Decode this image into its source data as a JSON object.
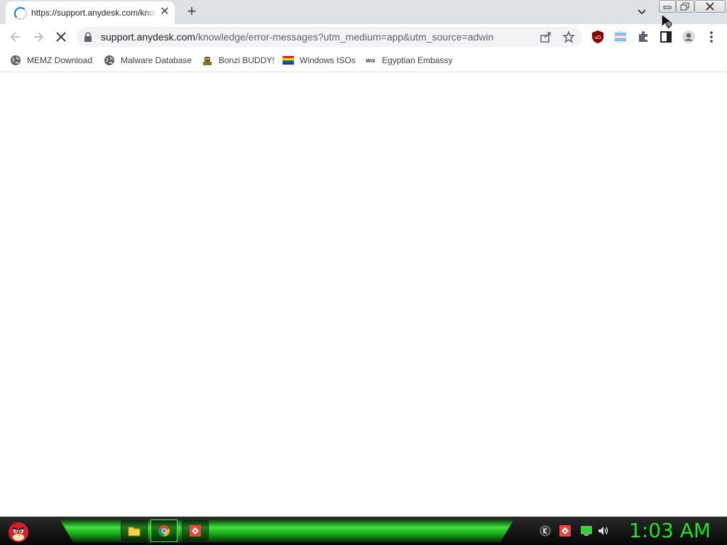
{
  "browser": {
    "tab": {
      "title": "https://support.anydesk.com/knowledge/error-messages",
      "close_glyph": "✕",
      "status": "loading"
    },
    "new_tab_glyph": "+",
    "address": {
      "host": "support.anydesk.com",
      "path": "/knowledge/error-messages?utm_medium=app&utm_source=adwin"
    },
    "bookmarks": [
      {
        "label": "MEMZ Download",
        "icon": "globe-icon"
      },
      {
        "label": "Malware Database",
        "icon": "globe-icon"
      },
      {
        "label": "Bonzi BUDDY!",
        "icon": "bonzi-icon"
      },
      {
        "label": "Windows ISOs",
        "icon": "rainbow-flag-icon"
      },
      {
        "label": "Egyptian Embassy",
        "icon": "wix-icon"
      }
    ],
    "extensions": {
      "ublock_label": "uO"
    },
    "wix_text": "WiX"
  },
  "taskbar": {
    "clock": "1:03 AM",
    "apps": [
      "folder-icon",
      "chrome-icon",
      "anydesk-icon"
    ]
  },
  "colors": {
    "accent": "#1a73e8",
    "taskbar_green": "#3fe03f",
    "clock_green": "#22e022"
  }
}
